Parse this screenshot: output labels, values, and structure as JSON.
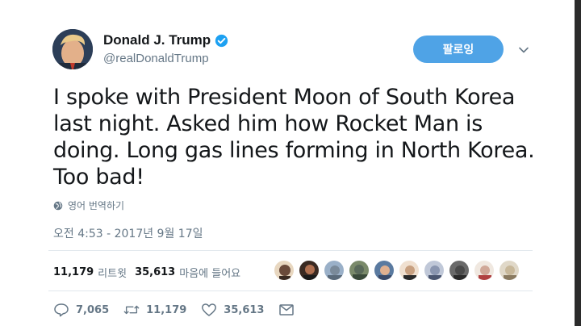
{
  "user": {
    "display_name": "Donald J. Trump",
    "handle": "@realDonaldTrump",
    "verified_icon": "verified-badge-icon"
  },
  "follow_button": {
    "label": "팔로잉"
  },
  "tweet": {
    "line1": "I spoke with President Moon of South Korea",
    "line2": "last night. Asked him how Rocket Man is",
    "line3": "doing. Long gas lines forming in North Korea.",
    "line4": "Too bad!"
  },
  "translate": {
    "label": "영어 번역하기",
    "icon": "globe-icon"
  },
  "timestamp": "오전 4:53 - 2017년 9월 17일",
  "stats": {
    "retweets_count": "11,179",
    "retweets_label": "리트윗",
    "likes_count": "35,613",
    "likes_label": "마음에 들어요"
  },
  "likers": {
    "colors": [
      "#6a4a3a",
      "#3a2a22",
      "#7a8a9a",
      "#5a6a5a",
      "#3a4a6a",
      "#c8a080",
      "#8a96b0",
      "#4a4a4a",
      "#d0a898",
      "#c8b89a"
    ]
  },
  "actions": {
    "reply_count": "7,065",
    "retweet_count": "11,179",
    "like_count": "35,613"
  },
  "colors": {
    "accent": "#4fa3e6",
    "muted": "#657786",
    "text": "#14171a"
  }
}
